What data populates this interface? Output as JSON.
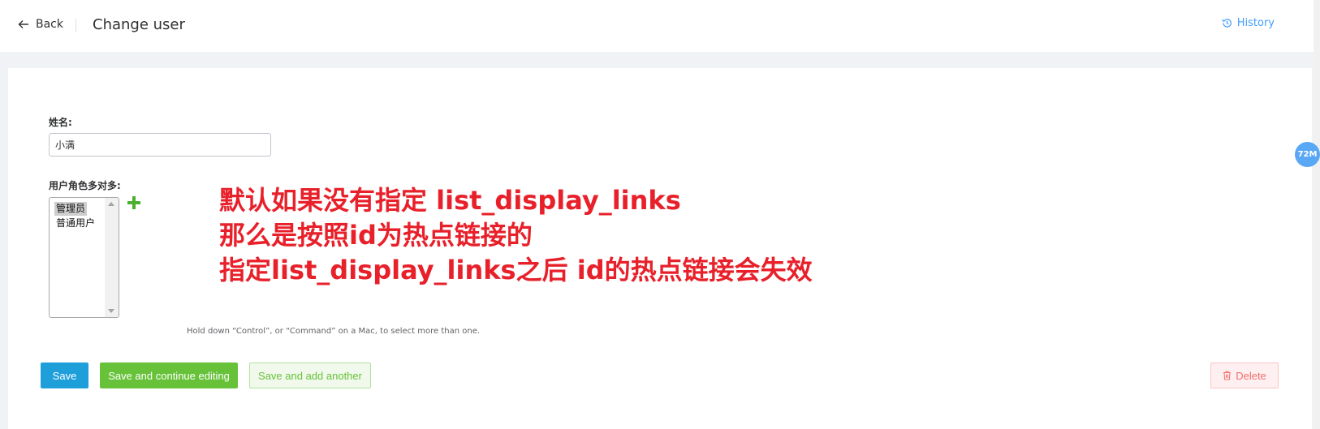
{
  "header": {
    "back_label": "Back",
    "title": "Change user",
    "history_label": "History"
  },
  "form": {
    "name_label": "姓名:",
    "name_value": "小满",
    "roles_label": "用户角色多对多:",
    "roles_options": [
      {
        "label": "管理员",
        "selected": true
      },
      {
        "label": "普通用户",
        "selected": false
      }
    ],
    "help_text": "Hold down “Control”, or “Command” on a Mac, to select more than one."
  },
  "annotation": {
    "lines": [
      "默认如果没有指定  list_display_links",
      "那么是按照id为热点链接的",
      "指定list_display_links之后 id的热点链接会失效"
    ]
  },
  "actions": {
    "save_label": "Save",
    "save_continue_label": "Save and continue editing",
    "save_add_label": "Save and add another",
    "delete_label": "Delete"
  },
  "badge": {
    "text": "72M"
  },
  "icons": {
    "back": "arrow-left-icon",
    "history": "history-icon",
    "add": "plus-icon",
    "delete": "trash-icon"
  },
  "colors": {
    "primary": "#1e9fda",
    "success": "#67c23a",
    "danger": "#f56c6c",
    "annotation": "#e8202a",
    "link": "#409eff"
  }
}
